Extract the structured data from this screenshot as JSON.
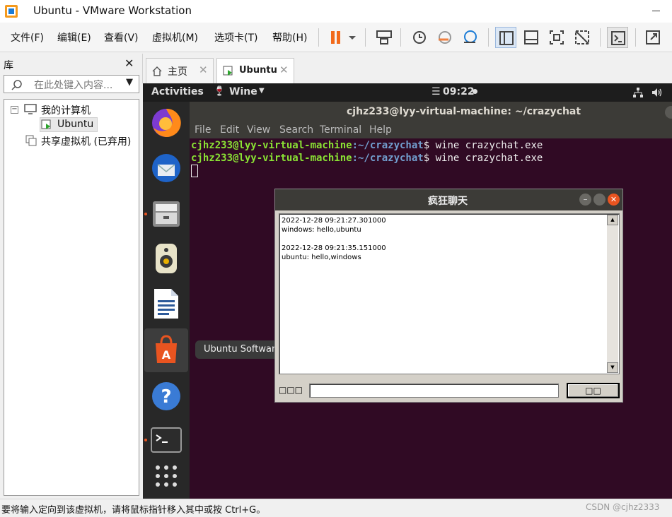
{
  "window": {
    "title": "Ubuntu - VMware Workstation"
  },
  "menu": [
    "文件(F)",
    "编辑(E)",
    "查看(V)",
    "虚拟机(M)",
    "选项卡(T)",
    "帮助(H)"
  ],
  "library": {
    "title": "库",
    "search_placeholder": "在此处键入内容...",
    "tree": {
      "root": "我的计算机",
      "vm": "Ubuntu",
      "shared": "共享虚拟机 (已弃用)"
    }
  },
  "tabs": [
    {
      "label": "主页"
    },
    {
      "label": "Ubuntu"
    }
  ],
  "gnome": {
    "activities": "Activities",
    "app": "Wine",
    "clock": "09:22"
  },
  "terminal": {
    "title": "cjhz233@lyy-virtual-machine: ~/crazychat",
    "menu": [
      "File",
      "Edit",
      "View",
      "Search",
      "Terminal",
      "Help"
    ],
    "prompt_user": "cjhz233@lyy-virtual-machine",
    "prompt_path": ":~/crazychat",
    "prompt_symbol": "$ ",
    "command": "wine crazychat.exe"
  },
  "tooltip": "Ubuntu Software",
  "chat": {
    "title": "疯狂聊天",
    "messages": [
      {
        "time": "2022-12-28 09:21:27.301000",
        "text": "windows: hello,ubuntu"
      },
      {
        "time": "2022-12-28 09:21:35.151000",
        "text": "ubuntu: hello,windows"
      }
    ],
    "input_label": "□□□",
    "send_label": "□□"
  },
  "status_text": "要将输入定向到该虚拟机，请将鼠标指针移入其中或按 Ctrl+G。",
  "watermark": "CSDN @cjhz2333"
}
